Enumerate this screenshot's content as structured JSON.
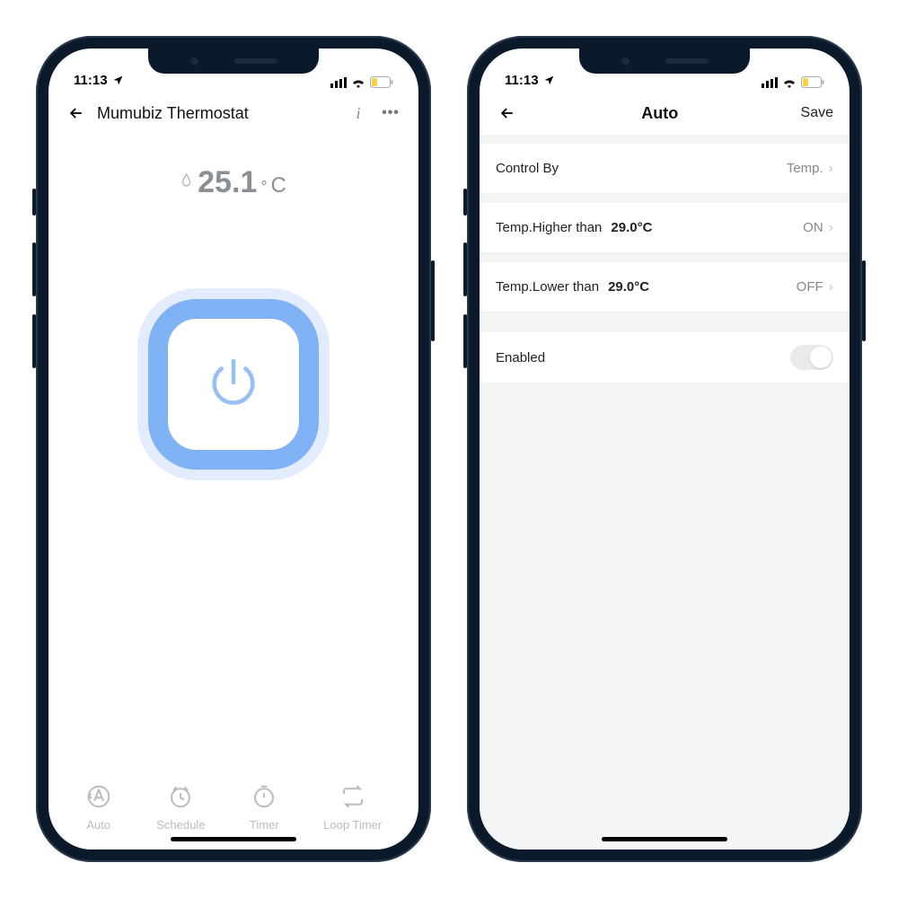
{
  "status": {
    "time": "11:13"
  },
  "phone1": {
    "title": "Mumubiz Thermostat",
    "temp_value": "25.1",
    "temp_deg": "°",
    "temp_c": "C",
    "tabs": [
      {
        "label": "Auto"
      },
      {
        "label": "Schedule"
      },
      {
        "label": "Timer"
      },
      {
        "label": "Loop Timer"
      }
    ]
  },
  "phone2": {
    "title": "Auto",
    "save": "Save",
    "rows": {
      "control_by": {
        "label": "Control By",
        "value": "Temp."
      },
      "higher": {
        "label": "Temp.Higher than",
        "threshold": "29.0°C",
        "state": "ON"
      },
      "lower": {
        "label": "Temp.Lower than",
        "threshold": "29.0°C",
        "state": "OFF"
      },
      "enabled": {
        "label": "Enabled"
      }
    }
  }
}
